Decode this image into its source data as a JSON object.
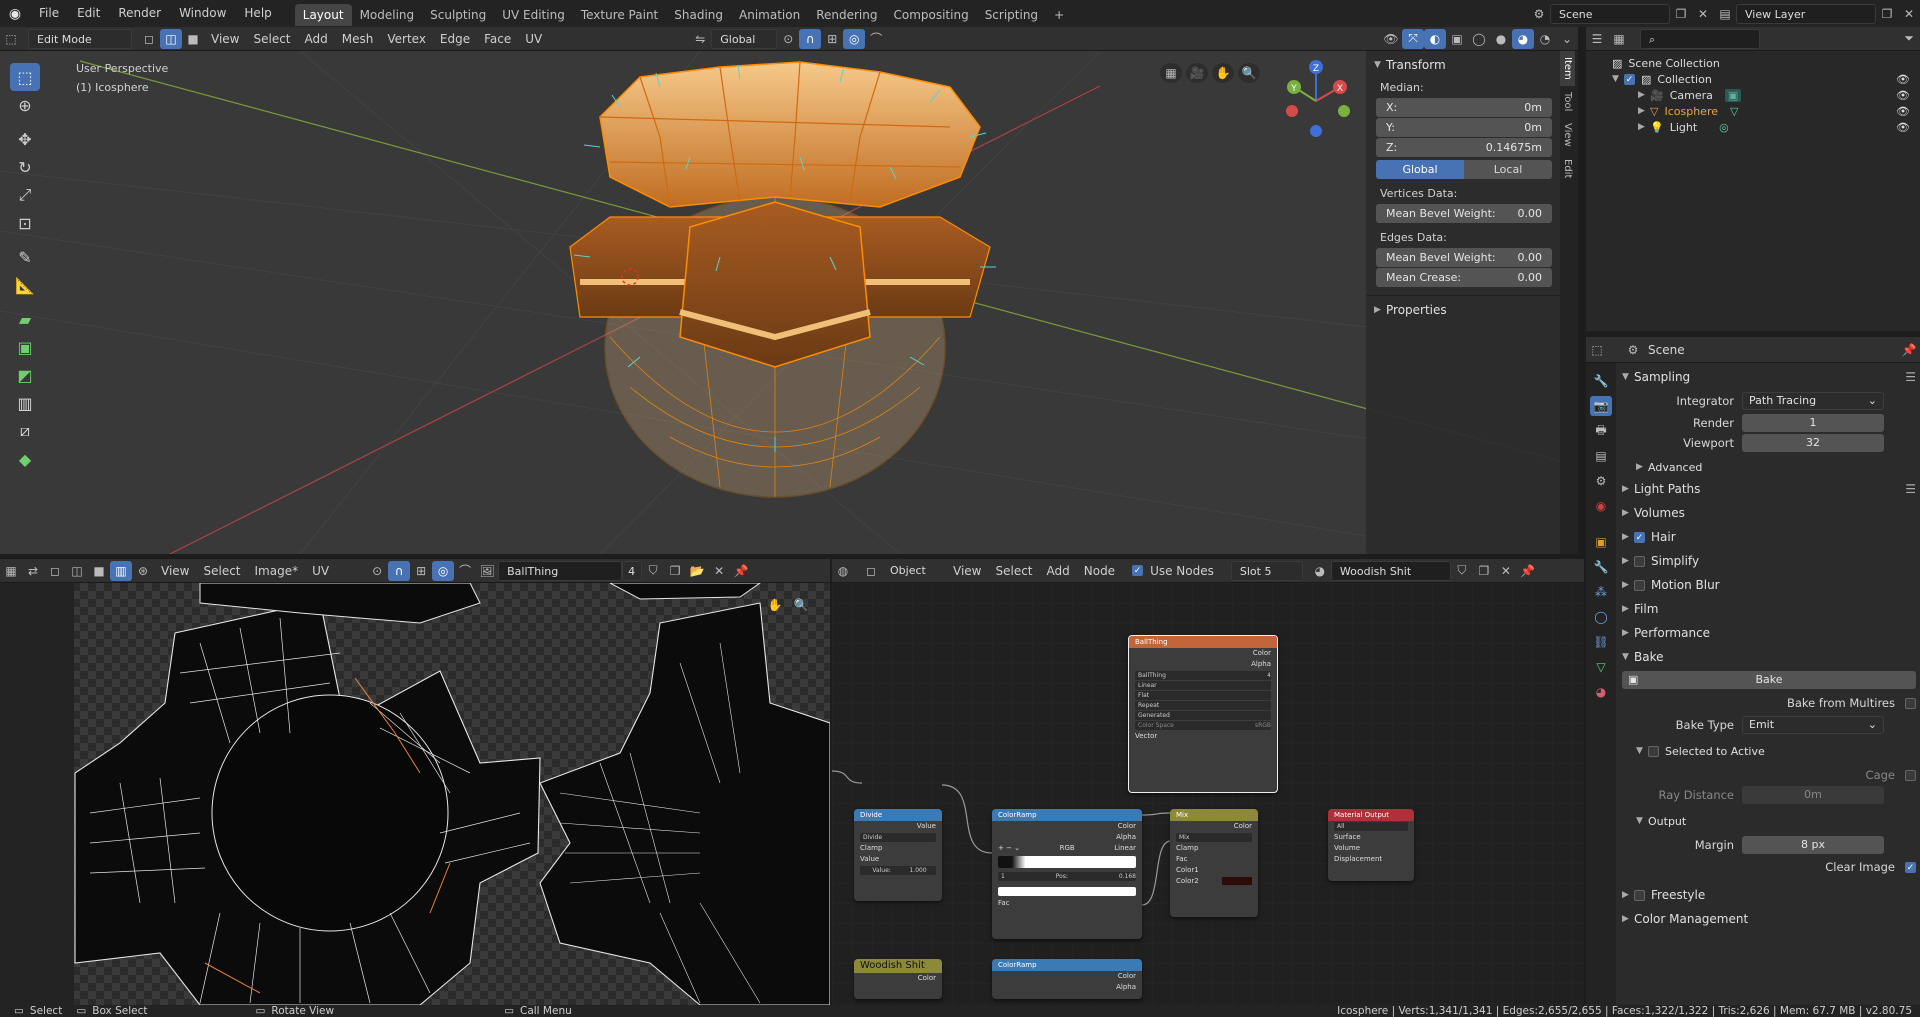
{
  "topbar": {
    "menus": [
      "File",
      "Edit",
      "Render",
      "Window",
      "Help"
    ],
    "workspaces": [
      "Layout",
      "Modeling",
      "Sculpting",
      "UV Editing",
      "Texture Paint",
      "Shading",
      "Animation",
      "Rendering",
      "Compositing",
      "Scripting"
    ],
    "active_workspace": "Layout",
    "scene_name": "Scene",
    "view_layer": "View Layer"
  },
  "viewport": {
    "mode": "Edit Mode",
    "menus": [
      "View",
      "Select",
      "Add",
      "Mesh",
      "Vertex",
      "Edge",
      "Face",
      "UV"
    ],
    "transform_orientation": "Global",
    "overlay_text_1": "User Perspective",
    "overlay_text_2": "(1) Icosphere",
    "gizmo_axes": [
      "X",
      "Y",
      "Z"
    ]
  },
  "npanel": {
    "title": "Transform",
    "median_label": "Median:",
    "x_label": "X:",
    "x_value": "0m",
    "y_label": "Y:",
    "y_value": "0m",
    "z_label": "Z:",
    "z_value": "0.14675m",
    "global_label": "Global",
    "local_label": "Local",
    "vertices_data_label": "Vertices Data:",
    "mean_bevel_label": "Mean Bevel Weight:",
    "mean_bevel_vert_value": "0.00",
    "edges_data_label": "Edges Data:",
    "mean_bevel_edge_value": "0.00",
    "mean_crease_label": "Mean Crease:",
    "mean_crease_value": "0.00",
    "properties_label": "Properties",
    "tabs": [
      "Item",
      "Tool",
      "View",
      "Edit"
    ]
  },
  "outliner": {
    "root": "Scene Collection",
    "collection": "Collection",
    "items": [
      "Camera",
      "Icosphere",
      "Light"
    ]
  },
  "properties": {
    "scene_name": "Scene",
    "sampling_label": "Sampling",
    "integrator_label": "Integrator",
    "integrator_value": "Path Tracing",
    "render_label": "Render",
    "render_value": "1",
    "viewport_label": "Viewport",
    "viewport_value": "32",
    "advanced_label": "Advanced",
    "light_paths_label": "Light Paths",
    "volumes_label": "Volumes",
    "hair_label": "Hair",
    "simplify_label": "Simplify",
    "motion_blur_label": "Motion Blur",
    "film_label": "Film",
    "performance_label": "Performance",
    "bake_section_label": "Bake",
    "bake_button": "Bake",
    "bake_multires_label": "Bake from Multires",
    "bake_type_label": "Bake Type",
    "bake_type_value": "Emit",
    "selected_to_active_label": "Selected to Active",
    "cage_label": "Cage",
    "ray_distance_label": "Ray Distance",
    "ray_distance_value": "0m",
    "output_label": "Output",
    "margin_label": "Margin",
    "margin_value": "8 px",
    "clear_image_label": "Clear Image",
    "freestyle_label": "Freestyle",
    "color_management_label": "Color Management"
  },
  "uv_editor": {
    "menus": [
      "View",
      "Select",
      "Image*",
      "UV"
    ],
    "image_name": "BallThing",
    "users": "4"
  },
  "node_editor": {
    "object_label": "Object",
    "menus": [
      "View",
      "Select",
      "Add",
      "Node"
    ],
    "use_nodes_label": "Use Nodes",
    "slot": "Slot 5",
    "material": "Woodish Shit",
    "nodes": {
      "image": {
        "title": "BallThing",
        "outputs": [
          "Color",
          "Alpha"
        ],
        "img_name": "BallThing",
        "users": "4",
        "interp": "Linear",
        "proj": "Flat",
        "ext": "Repeat",
        "src": "Generated",
        "cs_label": "Color Space",
        "cs_value": "sRGB",
        "input": "Vector"
      },
      "divide": {
        "title": "Divide",
        "output": "Value",
        "op": "Divide",
        "clamp": "Clamp",
        "in_label": "Value",
        "value_label": "Value:",
        "value": "1.000"
      },
      "ramp1": {
        "title": "ColorRamp",
        "outputs": [
          "Color",
          "Alpha"
        ],
        "mode": "RGB",
        "interp": "Linear",
        "index": "1",
        "pos_label": "Pos:",
        "pos": "0.168",
        "input": "Fac"
      },
      "mix": {
        "title": "Mix",
        "output": "Color",
        "blend": "Mix",
        "clamp": "Clamp",
        "inputs": [
          "Fac",
          "Color1",
          "Color2"
        ]
      },
      "output": {
        "title": "Material Output",
        "target": "All",
        "inputs": [
          "Surface",
          "Volume",
          "Displacement"
        ]
      },
      "woodish": {
        "title": "Woodish Shit",
        "output": "Color"
      },
      "ramp2": {
        "title": "ColorRamp",
        "outputs": [
          "Color",
          "Alpha"
        ]
      }
    }
  },
  "statusbar": {
    "select": "Select",
    "box_select": "Box Select",
    "rotate_view": "Rotate View",
    "call_menu": "Call Menu",
    "stats": "Icosphere | Verts:1,341/1,341 | Edges:2,655/2,655 | Faces:1,322/1,322 | Tris:2,626 | Mem: 67.7 MB | v2.80.75"
  },
  "colors": {
    "accent": "#4772b3",
    "selection_orange": "#ff8c00",
    "mesh_base": "#e9a35a"
  }
}
